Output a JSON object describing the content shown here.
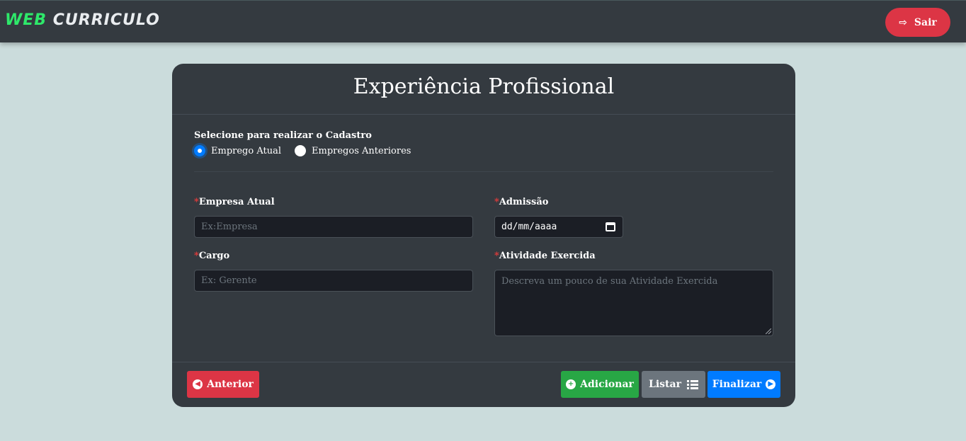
{
  "navbar": {
    "brand_part1": "WEB",
    "brand_part2": "CURRICULO",
    "logout_label": "Sair",
    "logout_icon": "sign-out-icon"
  },
  "form": {
    "title": "Experiência Profissional",
    "select_label": "Selecione para realizar o Cadastro",
    "radio_options": [
      {
        "label": "Emprego Atual",
        "checked": true
      },
      {
        "label": "Empregos Anteriores",
        "checked": false
      }
    ],
    "fields": {
      "empresa": {
        "required_mark": "*",
        "label": "Empresa Atual",
        "placeholder": "Ex:Empresa",
        "value": ""
      },
      "admissao": {
        "required_mark": "*",
        "label": "Admissão",
        "display_value": "dd/mm/aaaa"
      },
      "cargo": {
        "required_mark": "*",
        "label": "Cargo",
        "placeholder": "Ex: Gerente",
        "value": ""
      },
      "atividade": {
        "required_mark": "*",
        "label": "Atividade Exercida",
        "placeholder": "Descreva um pouco de sua Atividade Exercida",
        "value": ""
      }
    }
  },
  "footer": {
    "anterior_label": "Anterior",
    "adicionar_label": "Adicionar",
    "listar_label": "Listar",
    "finalizar_label": "Finalizar"
  },
  "colors": {
    "background": "#cbdcdc",
    "navbar": "#343a40",
    "brand_accent": "#2ee86a",
    "danger": "#dc3545",
    "success": "#28a745",
    "secondary": "#6c757d",
    "primary": "#007bff"
  }
}
